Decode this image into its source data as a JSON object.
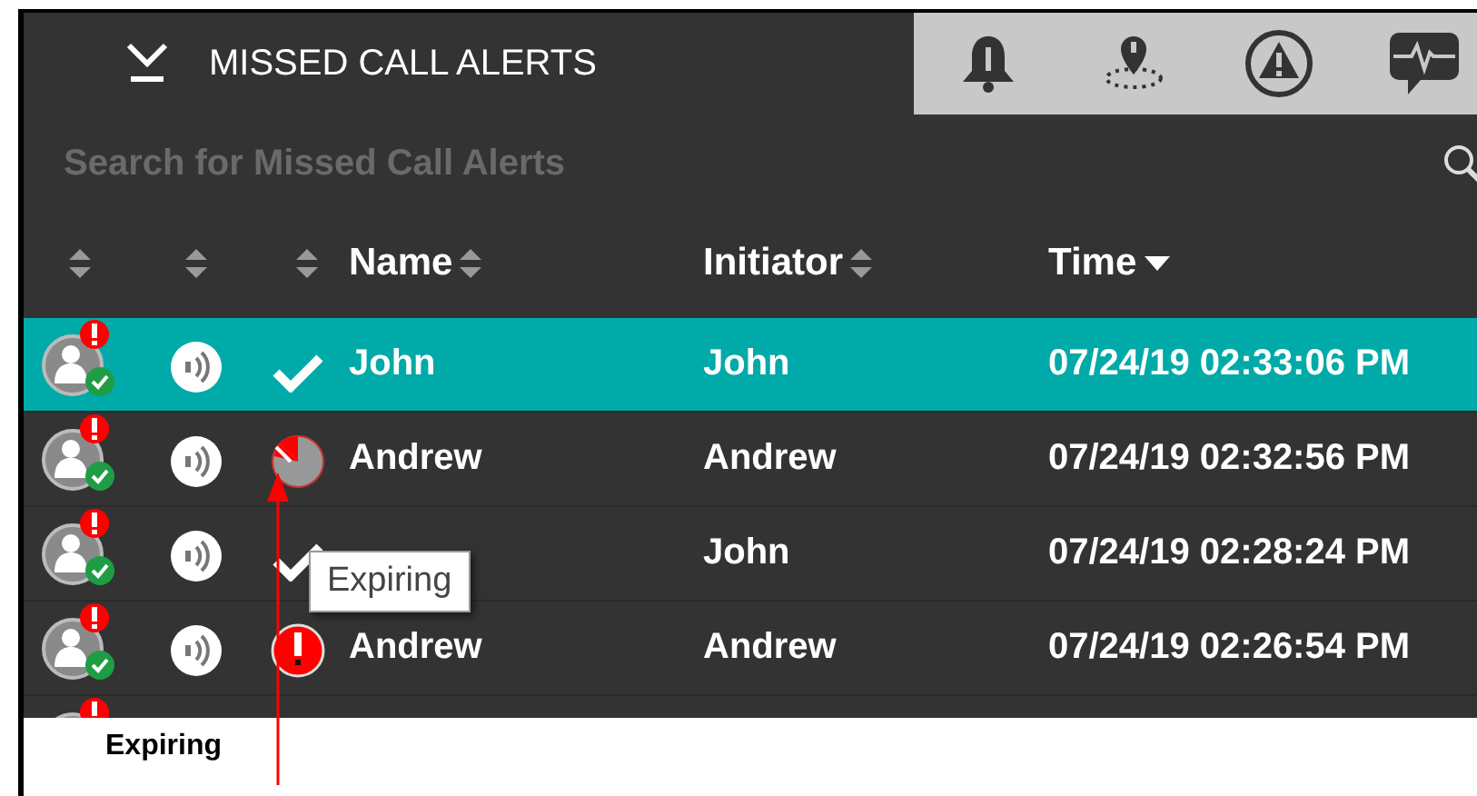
{
  "tabs": [
    {
      "kind": "missed",
      "label": "MISSED CALL ALERTS",
      "selected": true
    },
    {
      "kind": "bell",
      "selected": false
    },
    {
      "kind": "geofence",
      "selected": false
    },
    {
      "kind": "warning",
      "selected": false
    },
    {
      "kind": "pulse",
      "selected": false
    }
  ],
  "search": {
    "placeholder": "Search for Missed Call Alerts"
  },
  "columns": [
    {
      "kind": "both"
    },
    {
      "kind": "both"
    },
    {
      "kind": "both"
    },
    {
      "label": "Name",
      "kind": "both"
    },
    {
      "label": "Initiator",
      "kind": "both"
    },
    {
      "label": "Time",
      "kind": "desc"
    }
  ],
  "rows": [
    {
      "selected": true,
      "kind": "read",
      "name": "John",
      "initiator": "John",
      "time": "07/24/19 02:33:06 PM"
    },
    {
      "selected": false,
      "kind": "expiring",
      "name": "Andrew",
      "initiator": "Andrew",
      "time": "07/24/19 02:32:56 PM"
    },
    {
      "selected": false,
      "kind": "read",
      "initiator": "John",
      "time": "07/24/19 02:28:24 PM"
    },
    {
      "selected": false,
      "kind": "unread",
      "name": "Andrew",
      "initiator": "Andrew",
      "time": "07/24/19 02:26:54 PM"
    },
    {
      "selected": false
    }
  ],
  "tooltip": {
    "text": "Expiring"
  },
  "annotation": {
    "label": "Expiring"
  }
}
